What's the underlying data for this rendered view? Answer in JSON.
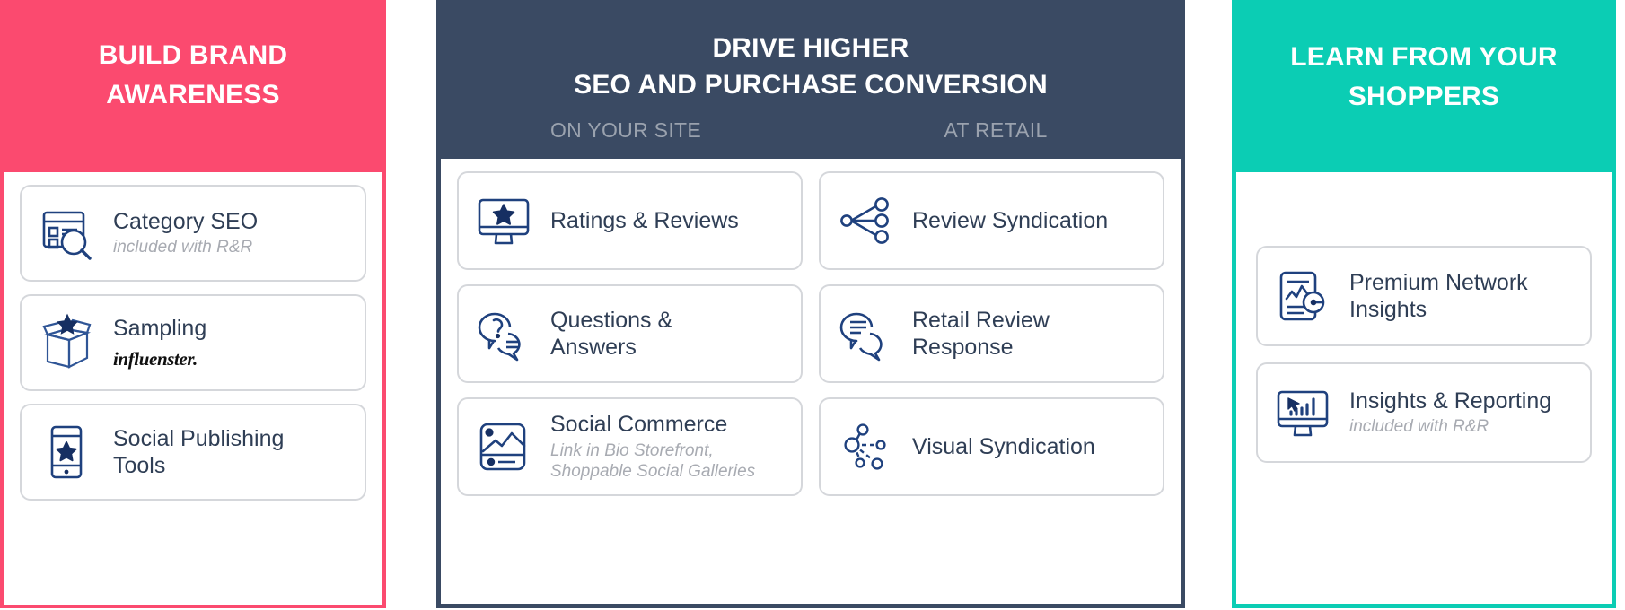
{
  "colors": {
    "pink": "#fb4a6f",
    "navy": "#3a4a63",
    "teal": "#0bcdb4",
    "icon_blue": "#1f417e",
    "title_text": "#2f3e55",
    "sub_text": "#a8abb2",
    "card_border": "#d5d7db",
    "header_sub_text": "#9aa2ae"
  },
  "panels": {
    "left": {
      "title": "BUILD BRAND\nAWARENESS",
      "cards": [
        {
          "title": "Category SEO",
          "sub": "included with R&R",
          "brand": "",
          "icon": "category-seo-icon"
        },
        {
          "title": "Sampling",
          "sub": "",
          "brand": "influenster.",
          "icon": "sampling-box-star-icon"
        },
        {
          "title": "Social Publishing\nTools",
          "sub": "",
          "brand": "",
          "icon": "mobile-star-icon"
        }
      ]
    },
    "middle": {
      "title": "DRIVE HIGHER\nSEO AND PURCHASE CONVERSION",
      "subheads": [
        "ON YOUR SITE",
        "AT RETAIL"
      ],
      "left_cards": [
        {
          "title": "Ratings & Reviews",
          "sub": "",
          "icon": "monitor-star-icon"
        },
        {
          "title": "Questions &\nAnswers",
          "sub": "",
          "icon": "question-chat-icon"
        },
        {
          "title": "Social Commerce",
          "sub": "Link in Bio Storefront,\nShoppable Social Galleries",
          "icon": "image-gallery-icon"
        }
      ],
      "right_cards": [
        {
          "title": "Review Syndication",
          "sub": "",
          "icon": "share-network-icon"
        },
        {
          "title": "Retail Review\nResponse",
          "sub": "",
          "icon": "chat-lines-icon"
        },
        {
          "title": "Visual Syndication",
          "sub": "",
          "icon": "visual-network-icon"
        }
      ]
    },
    "right": {
      "title": "LEARN FROM YOUR\nSHOPPERS",
      "cards": [
        {
          "title": "Premium Network\nInsights",
          "sub": "",
          "icon": "document-analytics-icon"
        },
        {
          "title": "Insights & Reporting",
          "sub": "included with R&R",
          "icon": "monitor-bars-cursor-icon"
        }
      ]
    }
  }
}
